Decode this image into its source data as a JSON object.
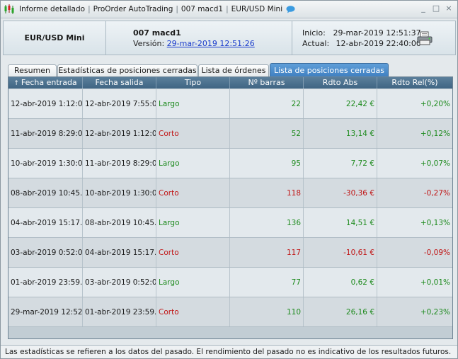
{
  "window": {
    "title_parts": [
      "Informe detallado",
      "ProOrder AutoTrading",
      "007 macd1",
      "EUR/USD Mini"
    ],
    "controls": [
      "_",
      "□",
      "×"
    ]
  },
  "header": {
    "instrument": "EUR/USD Mini",
    "strategy_name": "007 macd1",
    "version_label": "Versión:",
    "version_date": "29-mar-2019 12:51:26",
    "start_label": "Inicio:",
    "start_value": "29-mar-2019 12:51:37",
    "current_label": "Actual:",
    "current_value": "12-abr-2019 22:40:00"
  },
  "tabs": [
    {
      "label": "Resumen",
      "active": false
    },
    {
      "label": "Estadísticas de posiciones cerradas",
      "active": false
    },
    {
      "label": "Lista de órdenes",
      "active": false
    },
    {
      "label": "Lista de posiciones cerradas",
      "active": true
    }
  ],
  "table": {
    "columns": [
      "Fecha entrada",
      "Fecha salida",
      "Tipo",
      "Nº barras",
      "Rdto Abs",
      "Rdto Rel(%)"
    ],
    "sort_indicator": "↑",
    "rows": [
      {
        "entry": "12-abr-2019 1:12:00",
        "exit": "12-abr-2019 7:55:00",
        "type": "Largo",
        "bars": "22",
        "abs": "22,42 €",
        "rel": "+0,20%"
      },
      {
        "entry": "11-abr-2019 8:29:00",
        "exit": "12-abr-2019 1:12:00",
        "type": "Corto",
        "bars": "52",
        "abs": "13,14 €",
        "rel": "+0,12%"
      },
      {
        "entry": "10-abr-2019 1:30:00",
        "exit": "11-abr-2019 8:29:00",
        "type": "Largo",
        "bars": "95",
        "abs": "7,72 €",
        "rel": "+0,07%"
      },
      {
        "entry": "08-abr-2019 10:45...",
        "exit": "10-abr-2019 1:30:00",
        "type": "Corto",
        "bars": "118",
        "abs": "-30,36 €",
        "rel": "-0,27%"
      },
      {
        "entry": "04-abr-2019 15:17...",
        "exit": "08-abr-2019 10:45...",
        "type": "Largo",
        "bars": "136",
        "abs": "14,51 €",
        "rel": "+0,13%"
      },
      {
        "entry": "03-abr-2019 0:52:00",
        "exit": "04-abr-2019 15:17...",
        "type": "Corto",
        "bars": "117",
        "abs": "-10,61 €",
        "rel": "-0,09%"
      },
      {
        "entry": "01-abr-2019 23:59...",
        "exit": "03-abr-2019 0:52:00",
        "type": "Largo",
        "bars": "77",
        "abs": "0,62 €",
        "rel": "+0,01%"
      },
      {
        "entry": "29-mar-2019 12:52...",
        "exit": "01-abr-2019 23:59...",
        "type": "Corto",
        "bars": "110",
        "abs": "26,16 €",
        "rel": "+0,23%"
      }
    ]
  },
  "footer": "Las estadísticas se refieren a los datos del pasado. El rendimiento del pasado no es indicativo de los resultados futuros.",
  "colors": {
    "positive": "#1d8a1d",
    "negative": "#c01515",
    "active_tab": "#4a8ccb",
    "header_bar": "#4d7391"
  },
  "icons": [
    "chart-candles-icon",
    "chat-bubble-icon",
    "printer-icon",
    "sort-up-icon"
  ]
}
